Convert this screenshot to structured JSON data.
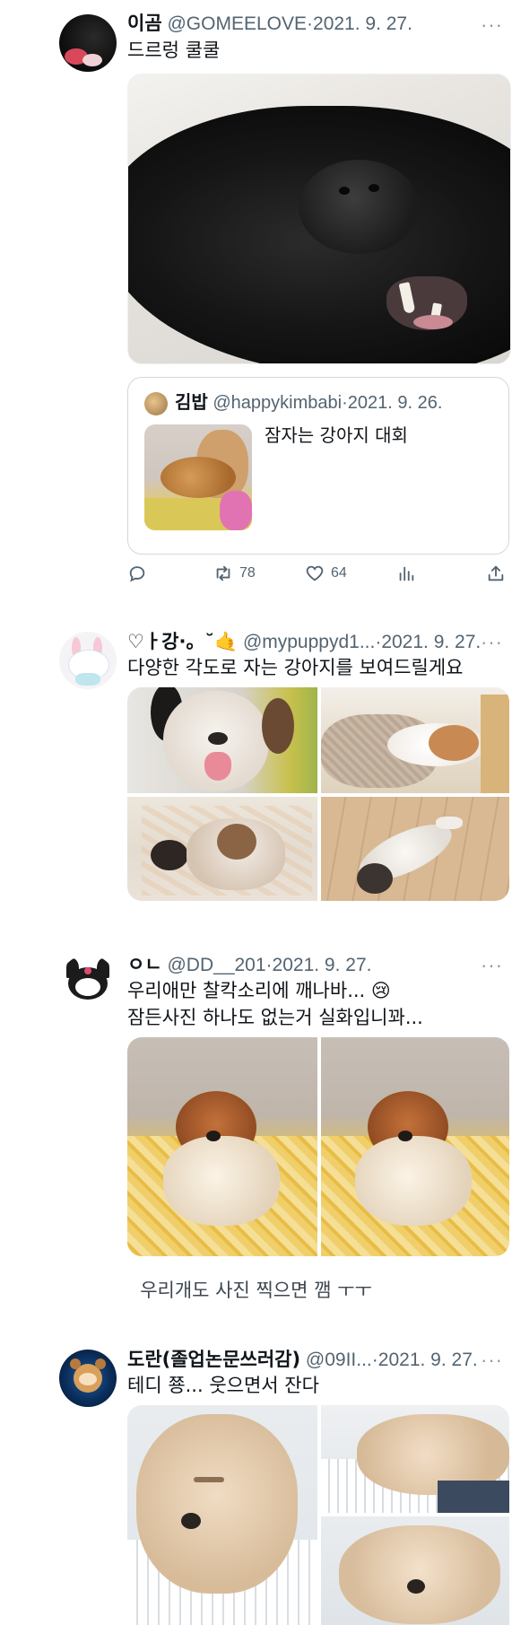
{
  "tweets": [
    {
      "name": "이곰",
      "handle": "@GOMEELOVE",
      "date": "2021. 9. 27.",
      "text": "드르렁 쿨쿨",
      "more": "···",
      "quote": {
        "name": "김밥",
        "handle": "@happykimbabi",
        "date": "2021. 9. 26.",
        "text": "잠자는 강아지 대회"
      },
      "actions": {
        "retweets": "78",
        "likes": "64"
      }
    },
    {
      "name": "♡ㅏ강·。˘🤙",
      "handle": "@mypuppyd1...",
      "date": "2021. 9. 27.",
      "text": "다양한 각도로 자는 강아지를 보여드릴게요",
      "more": "···"
    },
    {
      "name": "ㅇㄴ",
      "handle": "@DD__201",
      "date": "2021. 9. 27.",
      "text_line1": "우리애만 찰칵소리에 깨나바... 😢",
      "text_line2": "잠든사진 하나도 없는거 실화입니꽈...",
      "more": "···"
    },
    {
      "name": "도란(졸업논문쓰러감)",
      "handle": "@09II...",
      "date": "2021. 9. 27.",
      "text": "테디 쭁... 웃으면서 잔다",
      "more": "···"
    }
  ],
  "caption": "우리개도 사진 찍으면 깸 ㅜㅜ",
  "separator": "·",
  "icons": {
    "reply": "reply-icon",
    "retweet": "retweet-icon",
    "like": "heart-icon",
    "views": "analytics-icon",
    "share": "share-icon",
    "more": "more-icon"
  },
  "colors": {
    "text": "#0f1419",
    "secondary": "#536471",
    "border": "#cfd9de"
  }
}
